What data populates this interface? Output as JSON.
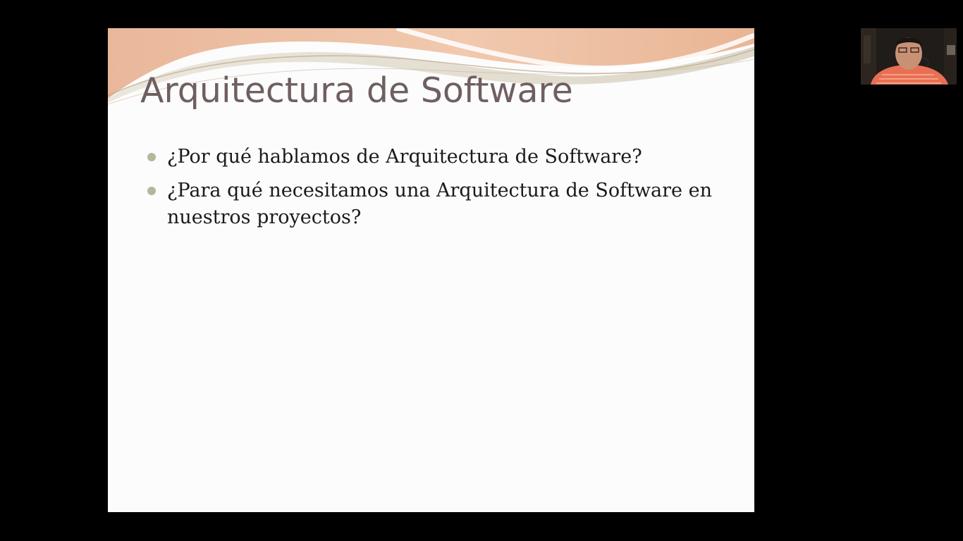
{
  "slide": {
    "title": "Arquitectura de Software",
    "bullets": [
      "¿Por qué hablamos de Arquitectura de Software?",
      "¿Para qué necesitamos una Arquitectura de Software en nuestros proyectos?"
    ]
  },
  "colors": {
    "background": "#000000",
    "slide_background": "#fcfcfd",
    "title_color": "#6f5f60",
    "bullet_dot": "#b3b89a",
    "header_wave_primary": "#eab79a",
    "header_wave_secondary": "#d9d5c4"
  },
  "icons": {
    "bullet": "circle-bullet-icon"
  }
}
